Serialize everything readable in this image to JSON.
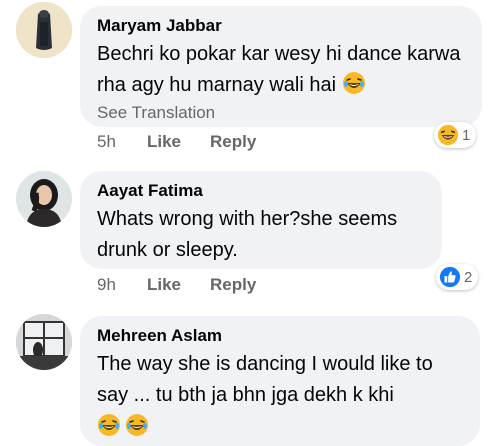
{
  "comments": [
    {
      "author": "Maryam Jabbar",
      "text": "Bechri ko pokar kar wesy hi dance karwa rha agy hu marnay wali hai",
      "trailing_emoji": "laughing-emoji",
      "see_translation": "See Translation",
      "time": "5h",
      "like_label": "Like",
      "reply_label": "Reply",
      "reaction": {
        "type": "haha",
        "count": "1"
      }
    },
    {
      "author": "Aayat Fatima",
      "text": "Whats wrong with her?she seems drunk or sleepy.",
      "time": "9h",
      "like_label": "Like",
      "reply_label": "Reply",
      "reaction": {
        "type": "like",
        "count": "2"
      }
    },
    {
      "author": "Mehreen Aslam",
      "text": "The way she is dancing I would like to say ... tu bth ja bhn jga dekh k khi",
      "trailing_emojis": [
        "laughing-emoji",
        "laughing-emoji"
      ]
    }
  ],
  "colors": {
    "bubble": "#f0f2f5",
    "secondary_text": "#65676b",
    "like_blue": "#1877f2",
    "haha_yellow": "#f7b928"
  }
}
